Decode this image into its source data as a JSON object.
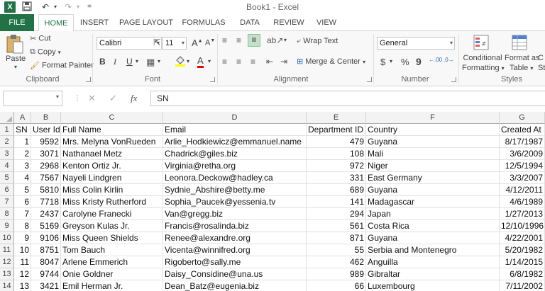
{
  "window": {
    "title": "Book1 - Excel"
  },
  "tabs": [
    {
      "label": "FILE",
      "key": "file"
    },
    {
      "label": "HOME",
      "key": "home"
    },
    {
      "label": "INSERT",
      "key": "insert"
    },
    {
      "label": "PAGE LAYOUT",
      "key": "pagelayout"
    },
    {
      "label": "FORMULAS",
      "key": "formulas"
    },
    {
      "label": "DATA",
      "key": "data"
    },
    {
      "label": "REVIEW",
      "key": "review"
    },
    {
      "label": "VIEW",
      "key": "view"
    }
  ],
  "ribbon": {
    "clipboard": {
      "paste": "Paste",
      "cut": "Cut",
      "copy": "Copy",
      "format_painter": "Format Painter",
      "label": "Clipboard"
    },
    "font": {
      "name": "Calibri",
      "size": "11",
      "label": "Font",
      "bold": "B",
      "italic": "I",
      "underline": "U",
      "grow": "A",
      "shrink": "A",
      "font_color": "A"
    },
    "alignment": {
      "wrap_text": "Wrap Text",
      "merge_center": "Merge & Center",
      "label": "Alignment"
    },
    "number": {
      "format": "General",
      "currency": "$",
      "percent": "%",
      "comma": "9",
      "inc_decimal": ".00",
      "dec_decimal": ".0",
      "label": "Number"
    },
    "styles": {
      "conditional": "Conditional",
      "formatting": "Formatting",
      "format_as": "Format as",
      "table": "Table",
      "cell_styles": "C",
      "cell_styles_2": "St",
      "label": "Styles"
    }
  },
  "formula_bar": {
    "name_box": "",
    "formula": "SN",
    "fx": "fx"
  },
  "columns": [
    "A",
    "B",
    "C",
    "D",
    "E",
    "F",
    "G"
  ],
  "header_row": [
    "SN",
    "User Id",
    "Full Name",
    "Email",
    "Department ID",
    "Country",
    "Created At"
  ],
  "rows": [
    [
      "1",
      "9592",
      "Mrs. Melyna VonRueden",
      "Arlie_Hodkiewicz@emmanuel.name",
      "479",
      "Guyana",
      "8/17/1987"
    ],
    [
      "2",
      "3071",
      "Nathanael Metz",
      "Chadrick@giles.biz",
      "108",
      "Mali",
      "3/6/2009"
    ],
    [
      "3",
      "2968",
      "Kenton Ortiz Jr.",
      "Virginia@retha.org",
      "972",
      "Niger",
      "12/5/1994"
    ],
    [
      "4",
      "7567",
      "Nayeli Lindgren",
      "Leonora.Deckow@hadley.ca",
      "331",
      "East Germany",
      "3/3/2007"
    ],
    [
      "5",
      "5810",
      "Miss Colin Kirlin",
      "Sydnie_Abshire@betty.me",
      "689",
      "Guyana",
      "4/12/2011"
    ],
    [
      "6",
      "7718",
      "Miss Kristy Rutherford",
      "Sophia_Paucek@yessenia.tv",
      "141",
      "Madagascar",
      "4/6/1989"
    ],
    [
      "7",
      "2437",
      "Carolyne Franecki",
      "Van@gregg.biz",
      "294",
      "Japan",
      "1/27/2013"
    ],
    [
      "8",
      "5169",
      "Greyson Kulas Jr.",
      "Francis@rosalinda.biz",
      "561",
      "Costa Rica",
      "12/10/1996"
    ],
    [
      "9",
      "9106",
      "Miss Queen Shields",
      "Renee@alexandre.org",
      "871",
      "Guyana",
      "4/22/2001"
    ],
    [
      "10",
      "8751",
      "Tom Bauch",
      "Vicenta@winnifred.org",
      "55",
      "Serbia and Montenegro",
      "5/20/1982"
    ],
    [
      "11",
      "8047",
      "Arlene Emmerich",
      "Rigoberto@sally.me",
      "462",
      "Anguilla",
      "1/14/2015"
    ],
    [
      "12",
      "9744",
      "Onie Goldner",
      "Daisy_Considine@una.us",
      "989",
      "Gibraltar",
      "6/8/1982"
    ],
    [
      "13",
      "3421",
      "Emil Herman Jr.",
      "Dean_Batz@eugenia.biz",
      "66",
      "Luxembourg",
      "7/11/2002"
    ]
  ],
  "colors": {
    "excel_green": "#217346"
  }
}
